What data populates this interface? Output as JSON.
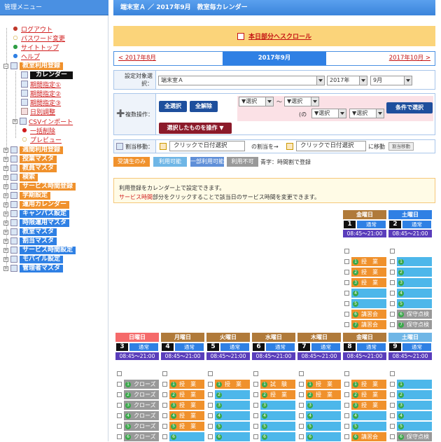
{
  "sidebar": {
    "title": "管理メニュー",
    "links": [
      "ログアウト",
      "パスワード変更",
      "サイトトップ",
      "ヘルプ"
    ],
    "reg_label": "教室利用登録",
    "reg_items": [
      "カレンダー",
      "期間指定①",
      "期間指定②",
      "期間指定③",
      "日別調整",
      "CSVインポート",
      "一括削除",
      "プレビュー"
    ],
    "groups": [
      {
        "label": "週間利用登録",
        "c": "or"
      },
      {
        "label": "授業マスタ",
        "c": "or"
      },
      {
        "label": "教員マスタ",
        "c": "or"
      },
      {
        "label": "検索",
        "c": "or"
      },
      {
        "label": "サービス時間登録",
        "c": "or"
      },
      {
        "label": "学期設定",
        "c": "or"
      },
      {
        "label": "運用カレンダー",
        "c": "or"
      },
      {
        "label": "キャンパス設定",
        "c": "bu"
      },
      {
        "label": "時限運用マスタ",
        "c": "bu"
      },
      {
        "label": "教室マスタ",
        "c": "bu"
      },
      {
        "label": "割当マスタ",
        "c": "bu"
      },
      {
        "label": "サービス時間設定",
        "c": "bu"
      },
      {
        "label": "モバイル設定",
        "c": "bu"
      },
      {
        "label": "管理者マスタ",
        "c": "bu"
      }
    ]
  },
  "header": {
    "title": "端末室Ａ ／ 2017年9月　教室毎カレンダー"
  },
  "scroll_link": "本日部分へスクロール",
  "nav": {
    "prev": "< 2017年8月",
    "current": "2017年9月",
    "next": "2017年10月 >"
  },
  "target": {
    "label": "設定対象選択：",
    "room": "端末室Ａ",
    "year": "2017年",
    "month": "9月"
  },
  "multi": {
    "label": "複数操作：",
    "select_all": "全選択",
    "deselect_all": "全解除",
    "op_select": "選択したものを操作",
    "sel_a": "▼選択",
    "tilde": "〜",
    "sel_b": "▼選択",
    "or_label": "(の",
    "sel_c": "▼選択",
    "sel_d": "▼選択",
    "cond_button": "条件で選択"
  },
  "assign": {
    "label": "割当移動：",
    "from_placeholder": "クリックで日付選択",
    "mid": "の割当を→",
    "to_placeholder": "クリックで日付選択",
    "tail": "に移動",
    "button": "割当移動"
  },
  "legend": {
    "items": [
      {
        "label": "受講生のみ",
        "color": "#f0912c"
      },
      {
        "label": "利用可能",
        "color": "#6fb6e6"
      },
      {
        "label": "一部利用可能",
        "color": "#5f8fd8"
      },
      {
        "label": "利用不可",
        "color": "#999999"
      }
    ],
    "note": "青字：時間割で登録"
  },
  "info": {
    "line1": "利用登録をカレンダー上で設定できます。",
    "line2_red": "サービス時間",
    "line2_rest": "部分をクリックすることで該当日のサービス時間を変更できます。"
  },
  "week1": [
    {
      "day": "金曜日",
      "num": "1",
      "std": "通常",
      "time": "08:45～21:00",
      "hc": "#b07a3a",
      "slots": [
        {
          "n": "1",
          "t": "授　業",
          "c": "or"
        },
        {
          "n": "2",
          "t": "授　業",
          "c": "or"
        },
        {
          "n": "3",
          "t": "授　業",
          "c": "or"
        },
        {
          "n": "4",
          "t": "",
          "c": "sky"
        },
        {
          "n": "5",
          "t": "",
          "c": "sky"
        },
        {
          "n": "6",
          "t": "講習会",
          "c": "or"
        },
        {
          "n": "7",
          "t": "講習会",
          "c": "or"
        }
      ]
    },
    {
      "day": "土曜日",
      "num": "2",
      "std": "通常",
      "time": "08:45～21:00",
      "hc": "#2f80e4",
      "slots": [
        {
          "n": "1",
          "t": "",
          "c": "sky"
        },
        {
          "n": "2",
          "t": "",
          "c": "sky"
        },
        {
          "n": "3",
          "t": "",
          "c": "sky"
        },
        {
          "n": "4",
          "t": "",
          "c": "sky"
        },
        {
          "n": "5",
          "t": "",
          "c": "sky"
        },
        {
          "n": "6",
          "t": "保守点検",
          "c": "gr"
        },
        {
          "n": "7",
          "t": "保守点検",
          "c": "gr"
        }
      ]
    }
  ],
  "week2": [
    {
      "day": "日曜日",
      "num": "3",
      "std": "通常",
      "time": "08:45～21:00",
      "hc": "#f56a6a",
      "slots": [
        {
          "n": "1",
          "t": "クローズ",
          "c": "gr"
        },
        {
          "n": "2",
          "t": "クローズ",
          "c": "gr"
        },
        {
          "n": "3",
          "t": "クローズ",
          "c": "gr"
        },
        {
          "n": "4",
          "t": "クローズ",
          "c": "gr"
        },
        {
          "n": "5",
          "t": "クローズ",
          "c": "gr"
        },
        {
          "n": "6",
          "t": "クローズ",
          "c": "gr"
        }
      ]
    },
    {
      "day": "月曜日",
      "num": "4",
      "std": "通常",
      "time": "08:45～21:00",
      "hc": "#b07a3a",
      "slots": [
        {
          "n": "1",
          "t": "授　業",
          "c": "or"
        },
        {
          "n": "2",
          "t": "授　業",
          "c": "or"
        },
        {
          "n": "3",
          "t": "授　業",
          "c": "or"
        },
        {
          "n": "4",
          "t": "授　業",
          "c": "or"
        },
        {
          "n": "5",
          "t": "授　業",
          "c": "or"
        },
        {
          "n": "6",
          "t": "",
          "c": "sky"
        }
      ]
    },
    {
      "day": "火曜日",
      "num": "5",
      "std": "通常",
      "time": "08:45～21:00",
      "hc": "#b07a3a",
      "slots": [
        {
          "n": "1",
          "t": "授　業",
          "c": "or"
        },
        {
          "n": "2",
          "t": "",
          "c": "sky"
        },
        {
          "n": "3",
          "t": "",
          "c": "sky"
        },
        {
          "n": "4",
          "t": "",
          "c": "sky"
        },
        {
          "n": "5",
          "t": "",
          "c": "sky"
        },
        {
          "n": "6",
          "t": "",
          "c": "sky"
        }
      ]
    },
    {
      "day": "水曜日",
      "num": "6",
      "std": "通常",
      "time": "08:45～21:00",
      "hc": "#b07a3a",
      "slots": [
        {
          "n": "1",
          "t": "試　験",
          "c": "or"
        },
        {
          "n": "2",
          "t": "授　業",
          "c": "or"
        },
        {
          "n": "3",
          "t": "",
          "c": "sky"
        },
        {
          "n": "4",
          "t": "",
          "c": "sky"
        },
        {
          "n": "5",
          "t": "",
          "c": "sky"
        },
        {
          "n": "6",
          "t": "",
          "c": "sky"
        }
      ]
    },
    {
      "day": "木曜日",
      "num": "7",
      "std": "通常",
      "time": "08:45～21:00",
      "hc": "#b07a3a",
      "slots": [
        {
          "n": "1",
          "t": "授　業",
          "c": "or"
        },
        {
          "n": "2",
          "t": "授　業",
          "c": "or"
        },
        {
          "n": "3",
          "t": "",
          "c": "sky"
        },
        {
          "n": "4",
          "t": "",
          "c": "sky"
        },
        {
          "n": "5",
          "t": "",
          "c": "sky"
        },
        {
          "n": "6",
          "t": "",
          "c": "sky"
        }
      ]
    },
    {
      "day": "金曜日",
      "num": "8",
      "std": "通常",
      "time": "08:45～21:00",
      "hc": "#b07a3a",
      "slots": [
        {
          "n": "1",
          "t": "授　業",
          "c": "or"
        },
        {
          "n": "2",
          "t": "授　業",
          "c": "or"
        },
        {
          "n": "3",
          "t": "授　業",
          "c": "or"
        },
        {
          "n": "4",
          "t": "",
          "c": "sky"
        },
        {
          "n": "5",
          "t": "",
          "c": "sky"
        },
        {
          "n": "6",
          "t": "講習会",
          "c": "or"
        }
      ]
    },
    {
      "day": "土曜日",
      "num": "9",
      "std": "通常",
      "time": "08:45～21:00",
      "hc": "#6fb6e6",
      "slots": [
        {
          "n": "1",
          "t": "",
          "c": "sky"
        },
        {
          "n": "2",
          "t": "",
          "c": "sky"
        },
        {
          "n": "3",
          "t": "",
          "c": "sky"
        },
        {
          "n": "4",
          "t": "",
          "c": "sky"
        },
        {
          "n": "5",
          "t": "",
          "c": "sky"
        },
        {
          "n": "6",
          "t": "保守点検",
          "c": "gr"
        }
      ]
    }
  ]
}
